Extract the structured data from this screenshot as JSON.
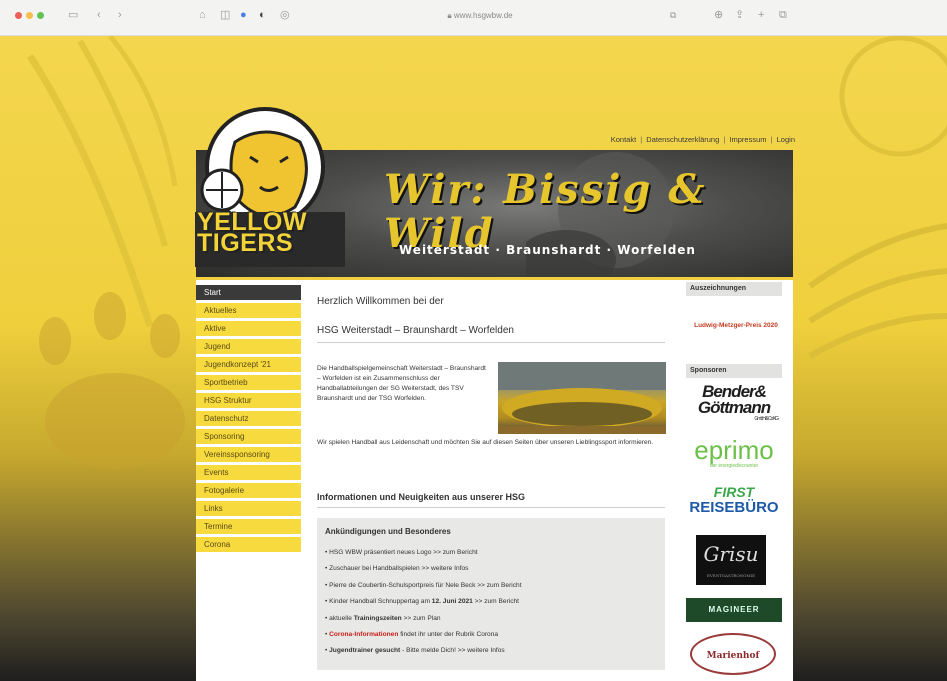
{
  "browser": {
    "url": "www.hsgwbw.de",
    "traffic_lights": [
      "#ec5f57",
      "#f4bd4f",
      "#5fc453"
    ]
  },
  "logo": {
    "line1": "YELLOW",
    "line2": "TIGERS"
  },
  "banner": {
    "title": "Wir: Bissig & Wild",
    "subtitle": "Weiterstadt · Braunshardt · Worfelden"
  },
  "top_links": {
    "kontakt": "Kontakt",
    "datenschutz": "Datenschutzerklärung",
    "impressum": "Impressum",
    "login": "Login"
  },
  "nav": [
    "Start",
    "Aktuelles",
    "Aktive",
    "Jugend",
    "Jugendkonzept '21",
    "Sportbetrieb",
    "HSG Struktur",
    "Datenschutz",
    "Sponsoring",
    "Vereinssponsoring",
    "Events",
    "Fotogalerie",
    "Links",
    "Termine",
    "Corona"
  ],
  "main": {
    "welcome": "Herzlich Willkommen bei der",
    "club_name": "HSG Weiterstadt – Braunshardt – Worfelden",
    "intro": "Die Handballspielgemeinschaft Weiterstadt – Braunshardt – Worfelden ist ein Zusammenschluss der Handballabteilungen der SG Weiterstadt, des TSV Braunshardt und der TSG Worfelden.",
    "lead": "Wir spielen Handball aus Leidenschaft und möchten Sie auf diesen Seiten über unseren Lieblingssport informieren.",
    "news_heading": "Informationen und Neuigkeiten aus unserer HSG"
  },
  "news_box": {
    "title": "Ankündigungen und Besonderes",
    "items": [
      {
        "pre": "HSG WBW präsentiert neues Logo",
        "strong": "",
        "post": " >> zum Bericht"
      },
      {
        "pre": "Zuschauer bei Handballspielen",
        "strong": "",
        "post": " >> weitere Infos"
      },
      {
        "pre": "Pierre de Coubertin-Schulsportpreis für Nele Beck",
        "strong": "",
        "post": " >> zum Bericht"
      },
      {
        "pre": "Kinder Handball Schnuppertag am ",
        "strong": "12. Juni 2021",
        "post": " >> zum Bericht"
      },
      {
        "pre": "aktuelle ",
        "strong": "Trainingszeiten",
        "post": " >> zum Plan"
      },
      {
        "pre": "",
        "strong": "Corona-Informationen",
        "post": " findet ihr unter der Rubrik Corona"
      },
      {
        "pre": "",
        "strong": "Jugendtrainer gesucht",
        "post": " - Bitte melde Dich! >> weitere Infos"
      }
    ]
  },
  "sidebar": {
    "awards_heading": "Auszeichnungen",
    "award": "Ludwig-Metzger-Preis 2020",
    "sponsors_heading": "Sponsoren",
    "sponsors": [
      {
        "name": "Bender&",
        "line2": "Göttmann",
        "sub": "GmbH & Co KG"
      },
      {
        "name": "eprimo",
        "sub": "der energiediscounter"
      },
      {
        "name": "FIRST",
        "line2": "REISEBÜRO"
      },
      {
        "name": "Grisu",
        "sub": "EVENTGASTRONOMIE"
      },
      {
        "name": "MAGINEER"
      },
      {
        "name": "Marienhof"
      }
    ]
  }
}
